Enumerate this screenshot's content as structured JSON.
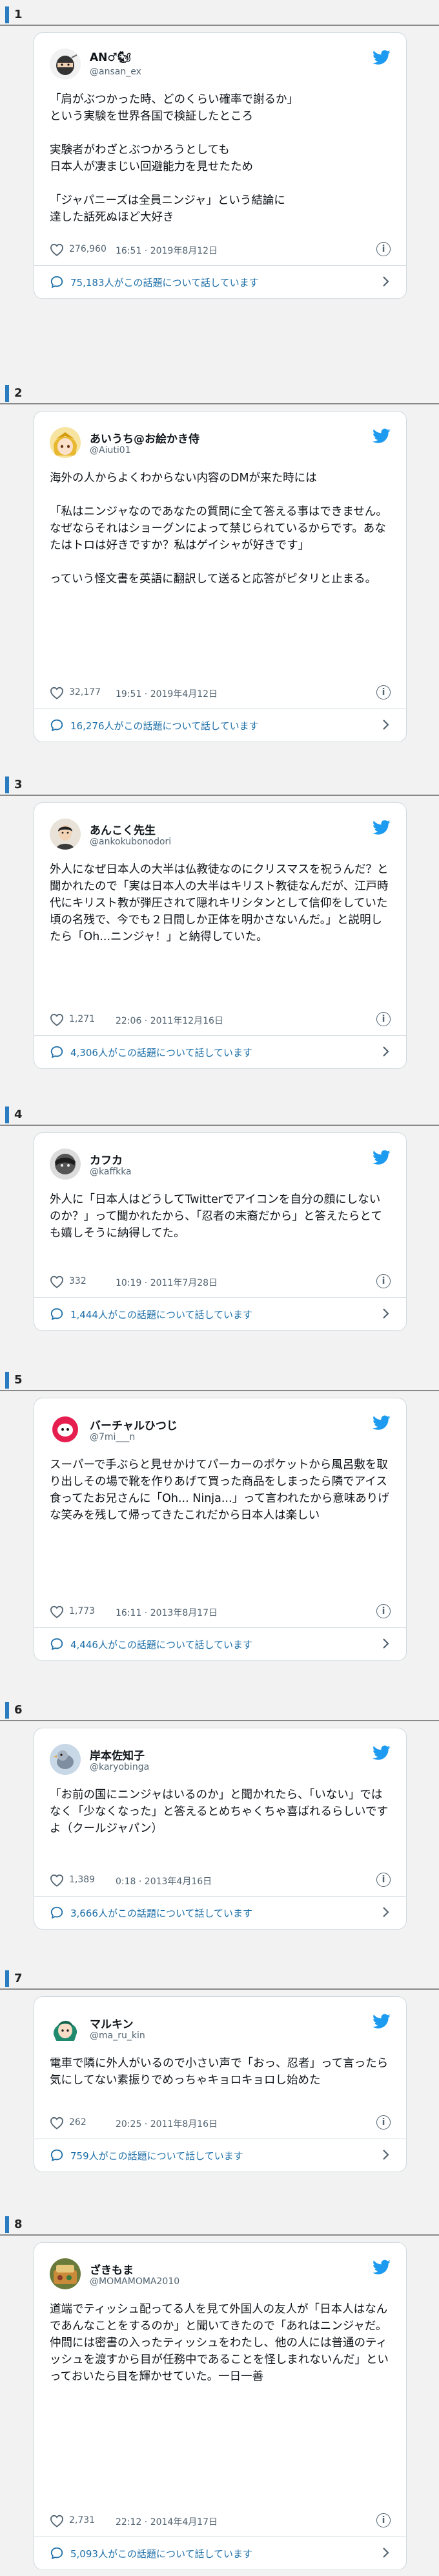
{
  "colors": {
    "accent": "#2a7cc0",
    "link": "#1d6fa8",
    "twitter": "#1d9bf0"
  },
  "tweets": [
    {
      "num": "1",
      "name": "AN♂🐿",
      "handle": "@ansan_ex",
      "text": "「肩がぶつかった時、どのくらい確率で謝るか」\nという実験を世界各国で検証したところ\n\n実験者がわざとぶつかろうとしても\n日本人が凄まじい回避能力を見せたため\n\n「ジャパニーズは全員ニンジャ」という結論に\n達した話死ぬほど大好き",
      "likes": "276,960",
      "time": "16:51 · 2019年8月12日",
      "talk": "75,183人がこの話題について話しています",
      "avatar": "ninja-icon"
    },
    {
      "num": "2",
      "name": "あいうち@お絵かき侍",
      "handle": "@Aiuti01",
      "text": "海外の人からよくわからない内容のDMが来た時には\n\n「私はニンジャなのであなたの質問に全て答える事はできません。なぜならそれはショーグンによって禁じられているからです。あなたはトロは好きですか？私はゲイシャが好きです」\n\nっていう怪文書を英語に翻訳して送ると応答がピタリと止まる。",
      "likes": "32,177",
      "time": "19:51 · 2019年4月12日",
      "talk": "16,276人がこの話題について話しています",
      "avatar": "anime-avatar"
    },
    {
      "num": "3",
      "name": "あんこく先生",
      "handle": "@ankokubonodori",
      "text": "外人になぜ日本人の大半は仏教徒なのにクリスマスを祝うんだ？と聞かれたので「実は日本人の大半はキリスト教徒なんだが、江戸時代にキリスト教が弾圧されて隠れキリシタンとして信仰をしていた頃の名残で、今でも２日間しか正体を明かさないんだ。」と説明したら「Oh...ニンジャ！」と納得していた。",
      "likes": "1,271",
      "time": "22:06 · 2011年12月16日",
      "talk": "4,306人がこの話題について話しています",
      "avatar": "portrait-avatar"
    },
    {
      "num": "4",
      "name": "カフカ",
      "handle": "@kaffkka",
      "text": "外人に「日本人はどうしてTwitterでアイコンを自分の顔にしないのか？」って聞かれたから、「忍者の末裔だから」と答えたらとても嬉しそうに納得してた。",
      "likes": "332",
      "time": "10:19 · 2011年7月28日",
      "talk": "1,444人がこの話題について話しています",
      "avatar": "mono-avatar"
    },
    {
      "num": "5",
      "name": "バーチャルひつじ",
      "handle": "@7mi___n",
      "text": "スーパーで手ぶらと見せかけてパーカーのポケットから風呂敷を取り出しその場で靴を作りあげて買った商品をしまったら隣でアイス食ってたお兄さんに「Oh... Ninja...」って言われたから意味ありげな笑みを残して帰ってきたこれだから日本人は楽しい",
      "likes": "1,773",
      "time": "16:11 · 2013年8月17日",
      "talk": "4,446人がこの話題について話しています",
      "avatar": "sheep-avatar"
    },
    {
      "num": "6",
      "name": "岸本佐知子",
      "handle": "@karyobinga",
      "text": "「お前の国にニンジャはいるのか」と聞かれたら、「いない」ではなく「少なくなった」と答えるとめちゃくちゃ喜ばれるらしいですよ（クールジャパン）",
      "likes": "1,389",
      "time": "0:18 · 2013年4月16日",
      "talk": "3,666人がこの話題について話しています",
      "avatar": "bird-avatar"
    },
    {
      "num": "7",
      "name": "マルキン",
      "handle": "@ma_ru_kin",
      "text": "電車で隣に外人がいるので小さい声で「おっ、忍者」って言ったら気にしてない素振りでめっちゃキョロキョロし始めた",
      "likes": "262",
      "time": "20:25 · 2011年8月16日",
      "talk": "759人がこの話題について話しています",
      "avatar": "green-hair-avatar"
    },
    {
      "num": "8",
      "name": "ざきもま",
      "handle": "@MOMAMOMA2010",
      "text": "道端でティッシュ配ってる人を見て外国人の友人が「日本人はなんであんなことをするのか」と聞いてきたので「あれはニンジャだ。仲間には密書の入ったティッシュをわたし、他の人には普通のティッシュを渡すから目が任務中であることを怪しまれないんだ」といっておいたら目を輝かせていた。一日一善",
      "likes": "2,731",
      "time": "22:12 · 2014年4月17日",
      "talk": "5,093人がこの話題について話しています",
      "avatar": "food-avatar"
    }
  ]
}
